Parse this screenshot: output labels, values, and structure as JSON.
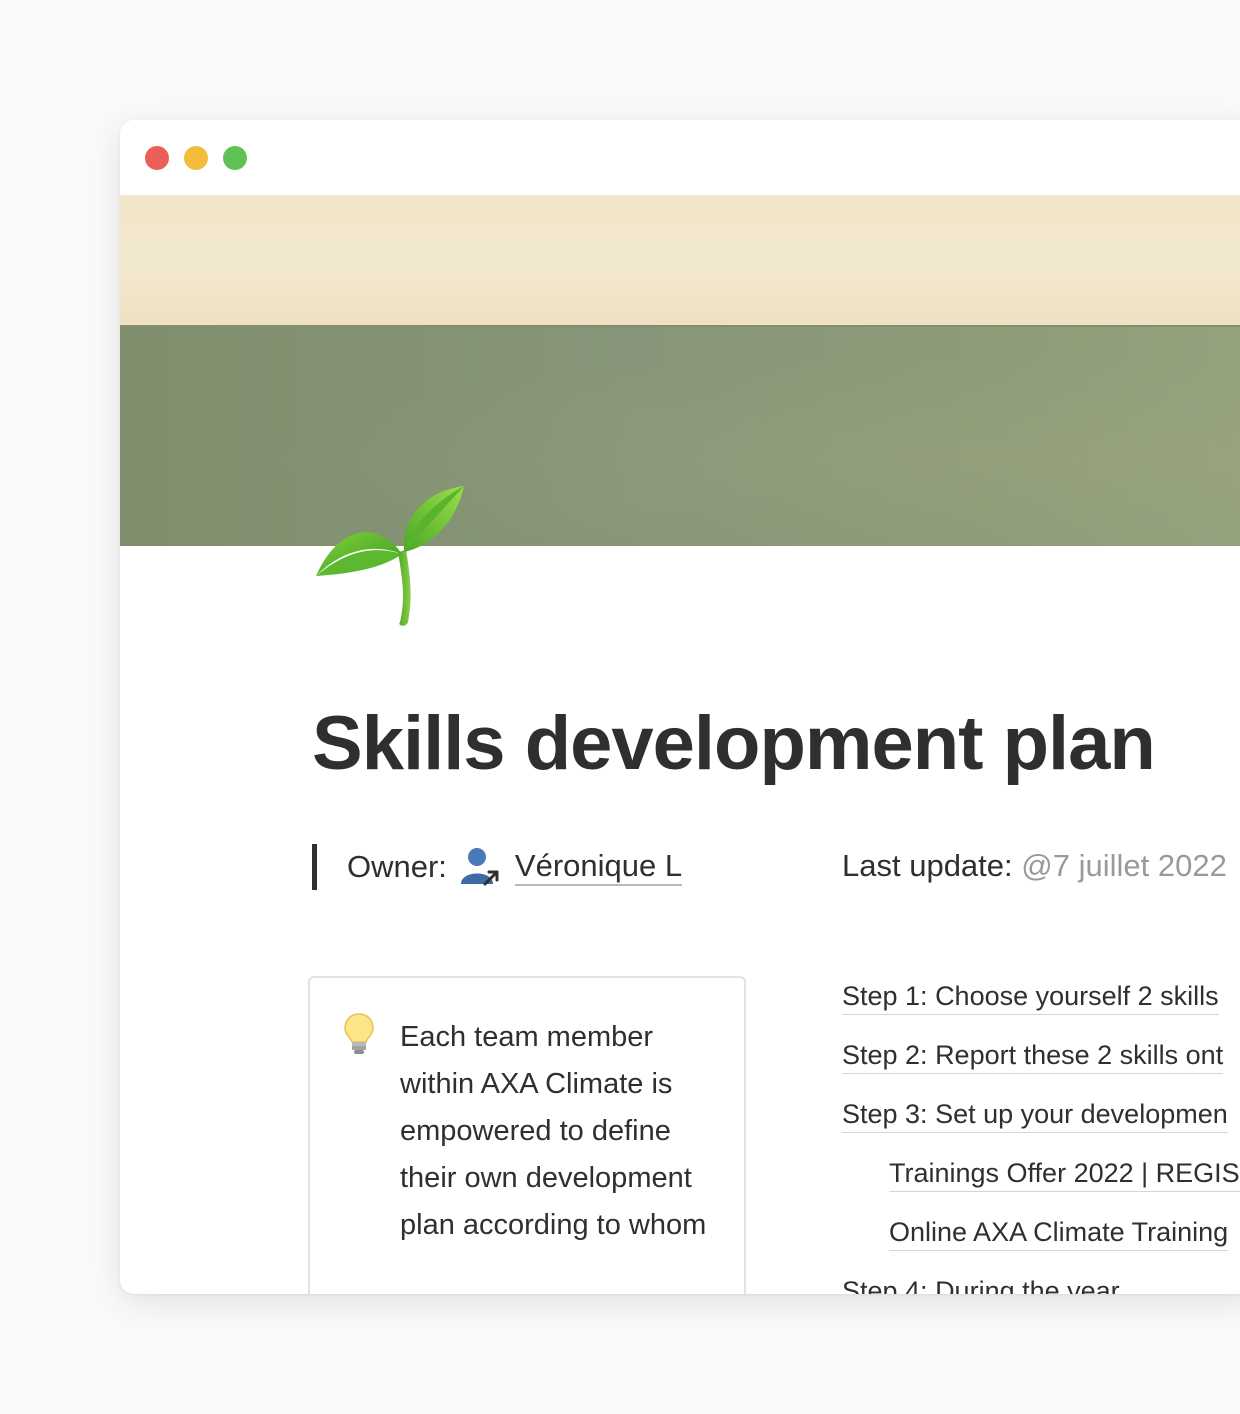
{
  "window": {
    "controls": [
      "close",
      "minimize",
      "maximize"
    ],
    "colors": {
      "close": "#ec5f58",
      "minimize": "#f4bc3b",
      "maximize": "#60c154"
    }
  },
  "cover": {
    "description_colors": {
      "top": "#f1e6c9",
      "bottom": "#87967a"
    }
  },
  "page": {
    "icon": "seedling-icon",
    "title": "Skills development plan",
    "owner": {
      "label": "Owner:",
      "icon": "person-link-icon",
      "name": "Véronique L"
    },
    "last_update": {
      "label": "Last update:",
      "date": "@7 juillet 2022"
    }
  },
  "callout": {
    "icon": "lightbulb-icon",
    "text": "Each team member within AXA Climate is empowered to define their own development plan according to whom"
  },
  "toc": {
    "items": [
      {
        "label": "Step 1: Choose yourself 2 skills",
        "indent": false
      },
      {
        "label": "Step 2: Report these 2 skills ont",
        "indent": false
      },
      {
        "label": "Step 3: Set up your developmen",
        "indent": false
      },
      {
        "label": "Trainings Offer 2022 | REGIS",
        "indent": true
      },
      {
        "label": "Online AXA Climate Training",
        "indent": true
      },
      {
        "label": "Step 4: During the year",
        "indent": false
      }
    ]
  }
}
